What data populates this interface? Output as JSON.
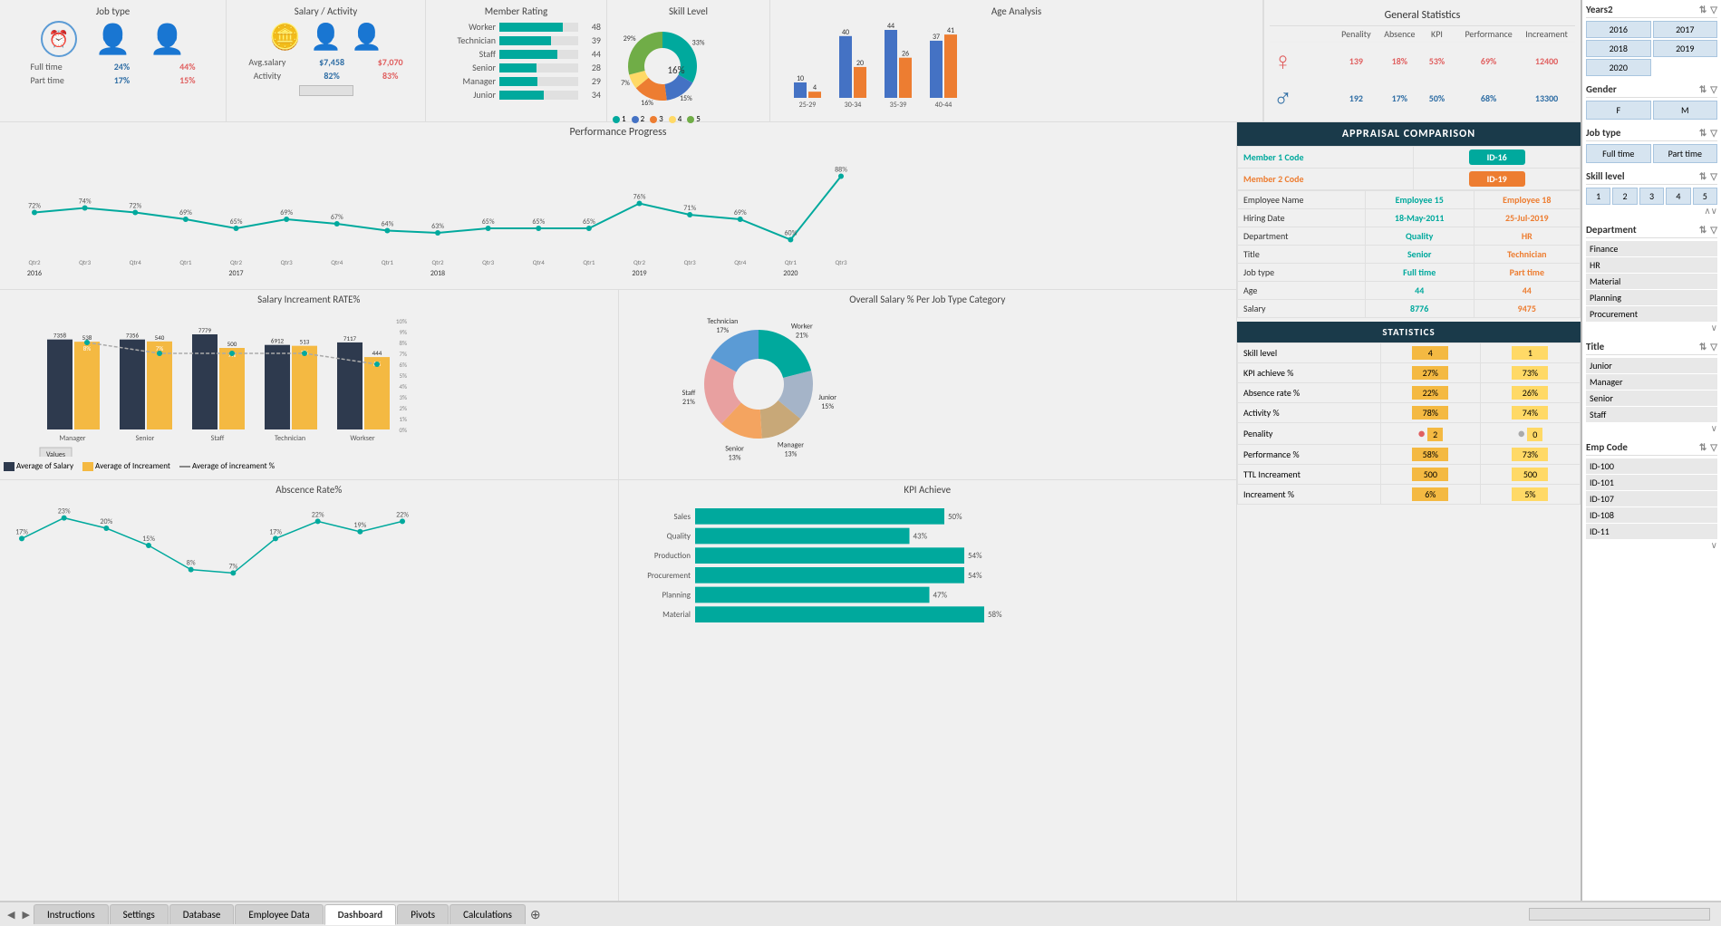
{
  "topCards": {
    "jobType": {
      "title": "Job type",
      "fullTimeLabel": "Full time",
      "partTimeLabel": "Part time",
      "maleFullTime": "24%",
      "femaleFullTime": "44%",
      "malePartTime": "17%",
      "femalePartTime": "15%"
    },
    "salaryActivity": {
      "title": "Salary / Activity",
      "avgSalaryLabel": "Avg.salary",
      "activityLabel": "Activity",
      "maleAvgSalary": "$7,458",
      "femaleAvgSalary": "$7,070",
      "maleActivity": "82%",
      "femaleActivity": "83%"
    },
    "memberRating": {
      "title": "Member Rating",
      "items": [
        {
          "label": "Worker",
          "value": 48,
          "max": 60
        },
        {
          "label": "Technician",
          "value": 39,
          "max": 60
        },
        {
          "label": "Staff",
          "value": 44,
          "max": 60
        },
        {
          "label": "Senior",
          "value": 28,
          "max": 60
        },
        {
          "label": "Manager",
          "value": 29,
          "max": 60
        },
        {
          "label": "Junior",
          "value": 34,
          "max": 60
        }
      ]
    },
    "skillLevel": {
      "title": "Skill Level",
      "segments": [
        {
          "label": "1",
          "value": 33,
          "color": "#00a99d"
        },
        {
          "label": "2",
          "value": 15,
          "color": "#4472c4"
        },
        {
          "label": "3",
          "value": 16,
          "color": "#ed7d31"
        },
        {
          "label": "4",
          "value": 7,
          "color": "#ffd966"
        },
        {
          "label": "5",
          "value": 29,
          "color": "#70ad47"
        }
      ]
    },
    "ageAnalysis": {
      "title": "Age Analysis",
      "groups": [
        {
          "range": "25-29",
          "male": 10,
          "female": 4
        },
        {
          "range": "30-34",
          "male": 40,
          "female": 20
        },
        {
          "range": "35-39",
          "male": 44,
          "female": 26
        },
        {
          "range": "40-44",
          "male": 37,
          "female": 41
        }
      ]
    }
  },
  "genStats": {
    "title": "General Statistics",
    "headers": [
      "Penality",
      "Absence",
      "KPI",
      "Performance",
      "Increament"
    ],
    "rows": [
      {
        "gender": "F",
        "penality": "139",
        "absence": "18%",
        "kpi": "53%",
        "performance": "69%",
        "increament": "12400"
      },
      {
        "gender": "M",
        "penality": "192",
        "absence": "17%",
        "kpi": "50%",
        "performance": "68%",
        "increament": "13300"
      }
    ]
  },
  "perfProgress": {
    "title": "Performance Progress",
    "values": [
      72,
      74,
      72,
      69,
      65,
      69,
      67,
      64,
      63,
      65,
      65,
      65,
      76,
      71,
      69,
      60,
      88
    ],
    "quarters": [
      "Qtr2",
      "Qtr3",
      "Qtr4",
      "Qtr1",
      "Qtr2",
      "Qtr3",
      "Qtr4",
      "Qtr1",
      "Qtr2",
      "Qtr3",
      "Qtr4",
      "Qtr1",
      "Qtr2",
      "Qtr3",
      "Qtr4",
      "Qtr1",
      "Qtr3"
    ],
    "years": [
      "2016",
      "2017",
      "2018",
      "2019",
      "2020"
    ]
  },
  "salaryRate": {
    "title": "Salary Increament RATE%",
    "categories": [
      "Manager",
      "Senior",
      "Staff",
      "Technician",
      "Workser"
    ],
    "avgSalary": [
      7358,
      7356,
      7779,
      6912,
      7117
    ],
    "avgIncreament": [
      538,
      540,
      500,
      513,
      444
    ],
    "avgIncreamentPct": [
      8,
      7,
      7,
      7,
      6
    ]
  },
  "overallSalary": {
    "title": "Overall Salary % Per Job Type Category",
    "segments": [
      {
        "label": "Worker\n21%",
        "value": 21,
        "color": "#00a99d"
      },
      {
        "label": "Junior\n15%",
        "value": 15,
        "color": "#a5b4c8"
      },
      {
        "label": "Manager\n13%",
        "value": 13,
        "color": "#c8a878"
      },
      {
        "label": "Senior\n13%",
        "value": 13,
        "color": "#f4a460"
      },
      {
        "label": "Staff\n21%",
        "value": 21,
        "color": "#e8a0a0"
      },
      {
        "label": "Technician\n17%",
        "value": 17,
        "color": "#5b9bd5"
      }
    ]
  },
  "absenceRate": {
    "title": "Abscence Rate%",
    "values": [
      17,
      23,
      20,
      15,
      8,
      7,
      17,
      22,
      19,
      22
    ]
  },
  "kpiAchieve": {
    "title": "KPI Achieve",
    "items": [
      {
        "label": "Sales",
        "value": 50
      },
      {
        "label": "Quality",
        "value": 43
      },
      {
        "label": "Production",
        "value": 54
      },
      {
        "label": "Procurement",
        "value": 54
      },
      {
        "label": "Planning",
        "value": 47
      },
      {
        "label": "Material",
        "value": 58
      }
    ]
  },
  "appraisal": {
    "title": "APPRAISAL COMPARISON",
    "member1Label": "Member 1 Code",
    "member2Label": "Member 2 Code",
    "member1Id": "ID-16",
    "member2Id": "ID-19",
    "rows": [
      {
        "label": "Employee Name",
        "val1": "Employee 15",
        "val2": "Employee 18"
      },
      {
        "label": "Hiring Date",
        "val1": "18-May-2011",
        "val2": "25-Jul-2019"
      },
      {
        "label": "Department",
        "val1": "Quality",
        "val2": "HR"
      },
      {
        "label": "Title",
        "val1": "Senior",
        "val2": "Technician"
      },
      {
        "label": "Job type",
        "val1": "Full time",
        "val2": "Part time"
      },
      {
        "label": "Age",
        "val1": "44",
        "val2": "44"
      },
      {
        "label": "Salary",
        "val1": "8776",
        "val2": "9475"
      }
    ]
  },
  "statistics": {
    "title": "STATISTICS",
    "rows": [
      {
        "label": "Skill level",
        "val1": "4",
        "val2": "1"
      },
      {
        "label": "KPI achieve %",
        "val1": "27%",
        "val2": "73%"
      },
      {
        "label": "Absence rate %",
        "val1": "22%",
        "val2": "26%"
      },
      {
        "label": "Activity %",
        "val1": "78%",
        "val2": "74%"
      },
      {
        "label": "Penality",
        "val1": "2",
        "val2": "0",
        "dot1": true,
        "dot2": true
      },
      {
        "label": "Performance %",
        "val1": "58%",
        "val2": "73%"
      },
      {
        "label": "TTL Increament",
        "val1": "500",
        "val2": "500"
      },
      {
        "label": "Increament %",
        "val1": "6%",
        "val2": "5%"
      }
    ]
  },
  "filterPanel": {
    "years2Label": "Years2",
    "years": [
      "2016",
      "2017",
      "2018",
      "2019",
      "2020"
    ],
    "genderLabel": "Gender",
    "genders": [
      "F",
      "M"
    ],
    "jobTypeLabel": "Job type",
    "jobTypes": [
      "Full time",
      "Part time"
    ],
    "skillLevelLabel": "Skill level",
    "skillLevels": [
      "1",
      "2",
      "3",
      "4",
      "5"
    ],
    "departmentLabel": "Department",
    "departments": [
      "Finance",
      "HR",
      "Material",
      "Planning",
      "Procurement"
    ],
    "titleLabel": "Title",
    "titles": [
      "Junior",
      "Manager",
      "Senior",
      "Staff"
    ],
    "empCodeLabel": "Emp Code",
    "empCodes": [
      "ID-100",
      "ID-101",
      "ID-107",
      "ID-108",
      "ID-11"
    ]
  },
  "tabs": {
    "items": [
      "Instructions",
      "Settings",
      "Database",
      "Employee Data",
      "Dashboard",
      "Pivots",
      "Calculations"
    ]
  },
  "legend": {
    "avgSalary": "Average of Salary",
    "avgIncreament": "Average of Increament",
    "avgIncreamentPct": "Average of increament %",
    "values": "Values"
  }
}
